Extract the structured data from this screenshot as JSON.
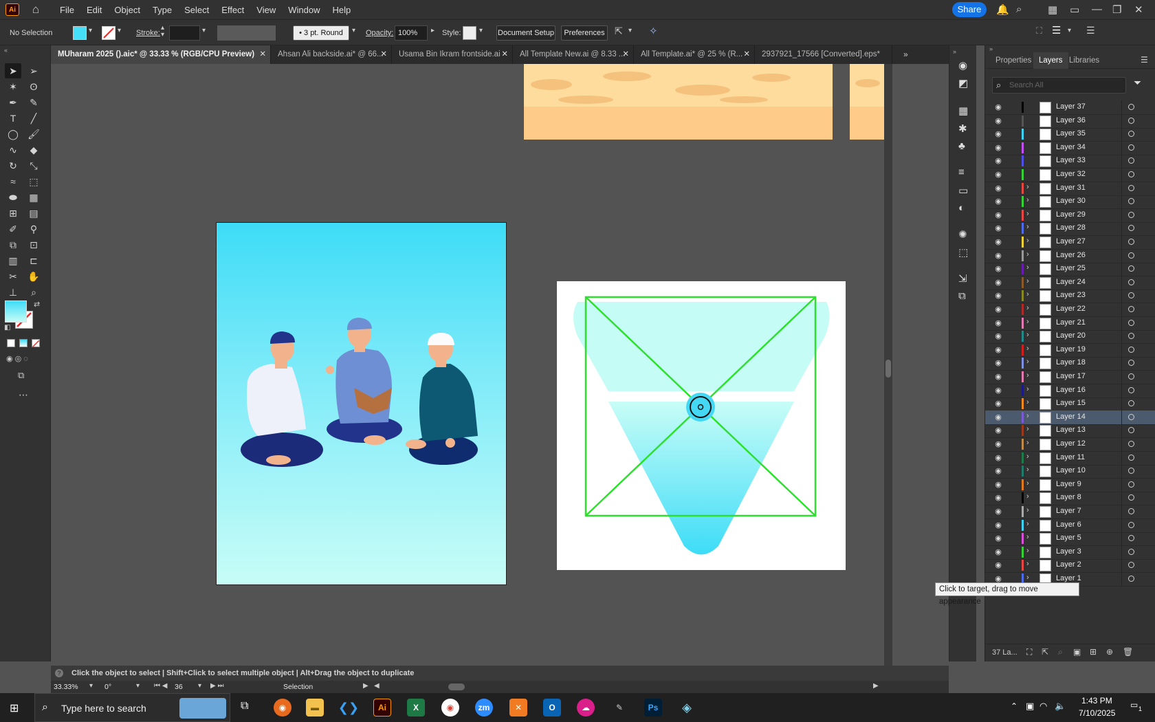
{
  "app": {
    "logo": "Ai",
    "home_icon": "home-icon"
  },
  "menu": [
    "File",
    "Edit",
    "Object",
    "Type",
    "Select",
    "Effect",
    "View",
    "Window",
    "Help"
  ],
  "share_label": "Share",
  "control_bar": {
    "selection": "No Selection",
    "stroke_label": "Stroke:",
    "brush_value": "3 pt. Round",
    "opacity_label": "Opacity:",
    "opacity_value": "100%",
    "style_label": "Style:",
    "document_setup": "Document Setup",
    "preferences": "Preferences"
  },
  "tabs": [
    {
      "label": "MUharam 2025 ().aic* @ 33.33 % (RGB/CPU Preview)",
      "active": true
    },
    {
      "label": "Ahsan Ali backside.ai* @ 66...",
      "active": false
    },
    {
      "label": "Usama Bin Ikram frontside.ai",
      "active": false
    },
    {
      "label": "All Template New.ai @ 8.33 ...",
      "active": false
    },
    {
      "label": "All Template.ai* @ 25 % (R...",
      "active": false
    },
    {
      "label": "2937921_17566 [Converted].eps*",
      "active": false
    }
  ],
  "panel": {
    "tabs": [
      "Properties",
      "Layers",
      "Libraries"
    ],
    "active_tab": "Layers",
    "search_placeholder": "Search All",
    "layers_count": "37 La...",
    "layers": [
      {
        "name": "Layer 37",
        "color": "#000000",
        "expand": false
      },
      {
        "name": "Layer 36",
        "color": "#555555",
        "expand": false
      },
      {
        "name": "Layer 35",
        "color": "#3ed2f5",
        "expand": false
      },
      {
        "name": "Layer 34",
        "color": "#c24ff0",
        "expand": false
      },
      {
        "name": "Layer 33",
        "color": "#4f4fe8",
        "expand": false
      },
      {
        "name": "Layer 32",
        "color": "#37d137",
        "expand": false
      },
      {
        "name": "Layer 31",
        "color": "#e84545",
        "expand": true
      },
      {
        "name": "Layer 30",
        "color": "#37d137",
        "expand": true
      },
      {
        "name": "Layer 29",
        "color": "#e84545",
        "expand": true
      },
      {
        "name": "Layer 28",
        "color": "#4f6be8",
        "expand": true
      },
      {
        "name": "Layer 27",
        "color": "#f0d23c",
        "expand": true
      },
      {
        "name": "Layer 26",
        "color": "#999999",
        "expand": true
      },
      {
        "name": "Layer 25",
        "color": "#6a1bb0",
        "expand": true
      },
      {
        "name": "Layer 24",
        "color": "#8a5a2b",
        "expand": true
      },
      {
        "name": "Layer 23",
        "color": "#888822",
        "expand": true
      },
      {
        "name": "Layer 22",
        "color": "#b02a2a",
        "expand": true
      },
      {
        "name": "Layer 21",
        "color": "#e07ab0",
        "expand": true
      },
      {
        "name": "Layer 20",
        "color": "#228a88",
        "expand": true
      },
      {
        "name": "Layer 19",
        "color": "#d01f1f",
        "expand": true
      },
      {
        "name": "Layer 18",
        "color": "#8090e0",
        "expand": true
      },
      {
        "name": "Layer 17",
        "color": "#e07ab0",
        "expand": true
      },
      {
        "name": "Layer 16",
        "color": "#1a1a8a",
        "expand": true
      },
      {
        "name": "Layer 15",
        "color": "#f08a1c",
        "expand": true
      },
      {
        "name": "Layer 14",
        "color": "#7a5ad8",
        "expand": true
      },
      {
        "name": "Layer 13",
        "color": "#9a3a1a",
        "expand": true
      },
      {
        "name": "Layer 12",
        "color": "#c08a4a",
        "expand": true
      },
      {
        "name": "Layer 11",
        "color": "#1f7a4a",
        "expand": true
      },
      {
        "name": "Layer 10",
        "color": "#1f7a6a",
        "expand": true
      },
      {
        "name": "Layer 9",
        "color": "#e07a1c",
        "expand": true
      },
      {
        "name": "Layer 8",
        "color": "#000000",
        "expand": true
      },
      {
        "name": "Layer 7",
        "color": "#aaaaaa",
        "expand": true
      },
      {
        "name": "Layer 6",
        "color": "#3ed2f5",
        "expand": true
      },
      {
        "name": "Layer 5",
        "color": "#d84fd8",
        "expand": true
      },
      {
        "name": "Layer 3",
        "color": "#37d137",
        "expand": true
      },
      {
        "name": "Layer 2",
        "color": "#e84545",
        "expand": true
      },
      {
        "name": "Layer 1",
        "color": "#4f6be8",
        "expand": true
      }
    ],
    "selected_layer": "Layer 14",
    "tooltip": "Click to target, drag to move appearance"
  },
  "status": {
    "hint": "Click the object to select  |  Shift+Click to select multiple object  |  Alt+Drag the object to duplicate",
    "zoom": "33.33%",
    "rotation": "0°",
    "artboard": "36",
    "tool": "Selection"
  },
  "taskbar": {
    "search_placeholder": "Type here to search",
    "time": "1:43 PM",
    "date": "7/10/2025",
    "notification_count": "1"
  },
  "colors": {
    "accent": "#1473e6",
    "canvas": "#535353",
    "artboard_gradient_top": "#3ddcf7",
    "artboard_gradient_bottom": "#c8fdf7",
    "guides": "#2ee02e"
  }
}
